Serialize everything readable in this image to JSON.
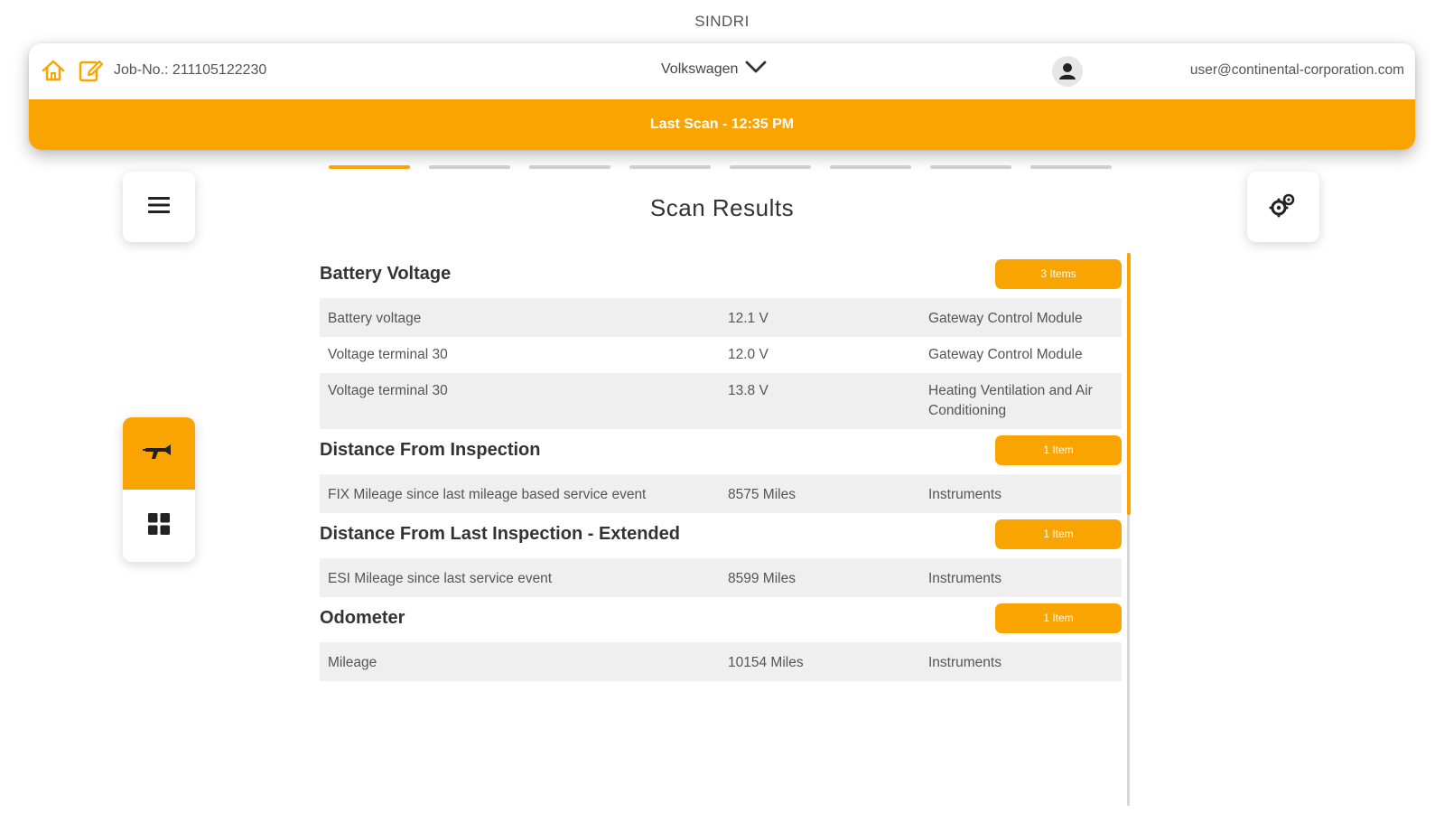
{
  "app": {
    "title": "SINDRI"
  },
  "header": {
    "job_label": "Job-No.: 211105122230",
    "brand": "Volkswagen",
    "user_email": "user@continental-corporation.com",
    "status": "Last Scan - 12:35 PM"
  },
  "stepper": {
    "total_steps": 8,
    "active_step": 1
  },
  "page": {
    "title": "Scan Results"
  },
  "colors": {
    "accent": "#f9a400",
    "row_shade": "#efefef",
    "text": "#333333"
  },
  "icons": {
    "home": "home-icon",
    "edit": "edit-note-icon",
    "chevron": "chevron-down-icon",
    "user": "user-avatar-icon",
    "menu": "hamburger-menu-icon",
    "settings": "gears-icon",
    "scan": "scan-tool-icon",
    "grid": "grid-icon"
  },
  "sections": [
    {
      "title": "Battery Voltage",
      "badge": "3 Items",
      "rows": [
        {
          "name": "Battery voltage",
          "value": "12.1 V",
          "module": "Gateway Control Module"
        },
        {
          "name": "Voltage terminal 30",
          "value": "12.0 V",
          "module": "Gateway Control Module"
        },
        {
          "name": "Voltage terminal 30",
          "value": "13.8 V",
          "module": "Heating Ventilation and Air Conditioning"
        }
      ]
    },
    {
      "title": "Distance From Inspection",
      "badge": "1 Item",
      "rows": [
        {
          "name": "FIX Mileage since last mileage based service event",
          "value": "8575 Miles",
          "module": "Instruments"
        }
      ]
    },
    {
      "title": "Distance From Last Inspection - Extended",
      "badge": "1 Item",
      "rows": [
        {
          "name": "ESI Mileage since last service event",
          "value": "8599 Miles",
          "module": "Instruments"
        }
      ]
    },
    {
      "title": "Odometer",
      "badge": "1 Item",
      "rows": [
        {
          "name": "Mileage",
          "value": "10154 Miles",
          "module": "Instruments"
        }
      ]
    }
  ]
}
